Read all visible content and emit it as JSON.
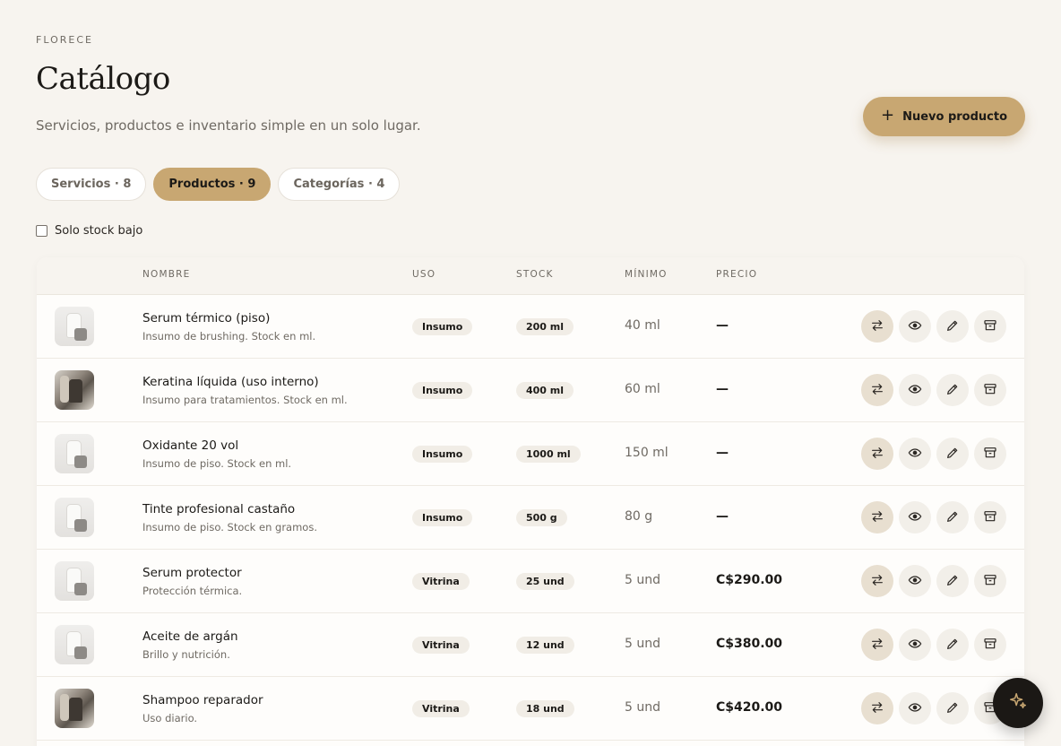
{
  "header": {
    "brand": "FLORECE",
    "title": "Catálogo",
    "subtitle": "Servicios, productos e inventario simple en un solo lugar.",
    "new_button_label": "Nuevo producto"
  },
  "tabs": [
    {
      "label": "Servicios · 8",
      "active": false
    },
    {
      "label": "Productos · 9",
      "active": true
    },
    {
      "label": "Categorías · 4",
      "active": false
    }
  ],
  "filter": {
    "label": "Solo stock bajo",
    "checked": false
  },
  "table": {
    "columns": {
      "nombre": "NOMBRE",
      "uso": "USO",
      "stock": "STOCK",
      "minimo": "MÍNIMO",
      "precio": "PRECIO"
    },
    "rows": [
      {
        "name": "Serum térmico (piso)",
        "desc": "Insumo de brushing. Stock en ml.",
        "uso": "Insumo",
        "stock": "200 ml",
        "minimo": "40 ml",
        "precio": "—",
        "thumb": "light"
      },
      {
        "name": "Keratina líquida (uso interno)",
        "desc": "Insumo para tratamientos. Stock en ml.",
        "uso": "Insumo",
        "stock": "400 ml",
        "minimo": "60 ml",
        "precio": "—",
        "thumb": "dark"
      },
      {
        "name": "Oxidante 20 vol",
        "desc": "Insumo de piso. Stock en ml.",
        "uso": "Insumo",
        "stock": "1000 ml",
        "minimo": "150 ml",
        "precio": "—",
        "thumb": "light"
      },
      {
        "name": "Tinte profesional castaño",
        "desc": "Insumo de piso. Stock en gramos.",
        "uso": "Insumo",
        "stock": "500 g",
        "minimo": "80 g",
        "precio": "—",
        "thumb": "light"
      },
      {
        "name": "Serum protector",
        "desc": "Protección térmica.",
        "uso": "Vitrina",
        "stock": "25 und",
        "minimo": "5 und",
        "precio": "C$290.00",
        "thumb": "light"
      },
      {
        "name": "Aceite de argán",
        "desc": "Brillo y nutrición.",
        "uso": "Vitrina",
        "stock": "12 und",
        "minimo": "5 und",
        "precio": "C$380.00",
        "thumb": "light"
      },
      {
        "name": "Shampoo reparador",
        "desc": "Uso diario.",
        "uso": "Vitrina",
        "stock": "18 und",
        "minimo": "5 und",
        "precio": "C$420.00",
        "thumb": "dark"
      }
    ]
  },
  "icons": {
    "new": "plus-icon",
    "actions": [
      "transfer-icon",
      "eye-icon",
      "pencil-icon",
      "archive-icon"
    ],
    "fab": "sparkles-icon"
  },
  "colors": {
    "accent": "#c8a772",
    "background": "#f7f4ef",
    "fab": "#1b1815"
  }
}
